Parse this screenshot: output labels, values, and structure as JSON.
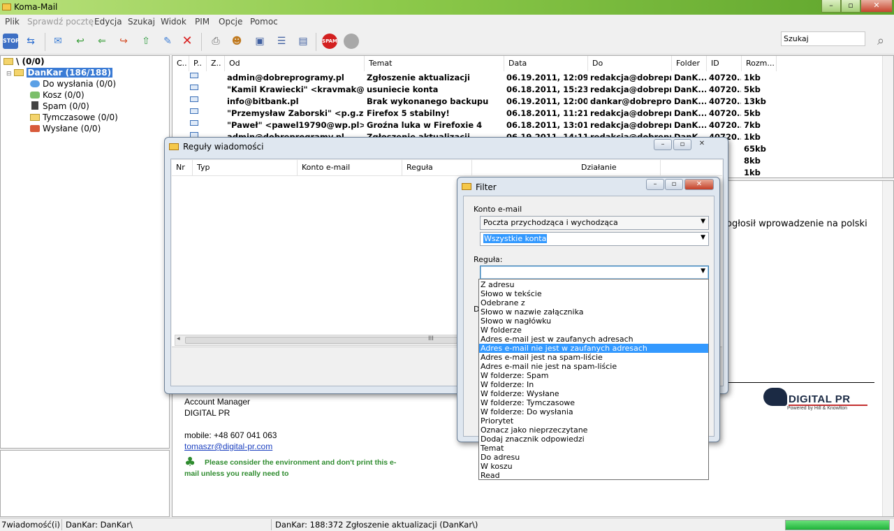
{
  "window": {
    "title": "Koma-Mail"
  },
  "menu": [
    "Plik",
    "Sprawdź pocztę",
    "Edycja",
    "Szukaj",
    "Widok",
    "PIM",
    "Opcje",
    "Pomoc"
  ],
  "search": {
    "value": "Szukaj"
  },
  "folders": {
    "root": "\\ (0/0)",
    "account": "DanKar (186/188)",
    "items": [
      "Do wysłania (0/0)",
      "Kosz (0/0)",
      "Spam (0/0)",
      "Tymczasowe (0/0)",
      "Wysłane (0/0)"
    ]
  },
  "messages": {
    "columns": [
      "C..",
      "P..",
      "Z..",
      "Od",
      "Temat",
      "Data",
      "Do",
      "Folder",
      "ID",
      "Rozm..."
    ],
    "rows": [
      {
        "from": "admin@dobreprogramy.pl",
        "subject": "Zgłoszenie aktualizacji",
        "date": "06.19.2011, 12:09:...",
        "to": "redakcja@dobrepr...",
        "folder": "DanK...",
        "id": "40720...",
        "size": "1kb"
      },
      {
        "from": "\"Kamil Krawiecki\" <kravmak@g...",
        "subject": "usuniecie konta",
        "date": "06.18.2011, 15:23:...",
        "to": "redakcja@dobrepr...",
        "folder": "DanK...",
        "id": "40720...",
        "size": "5kb"
      },
      {
        "from": "info@bitbank.pl",
        "subject": "Brak wykonanego backupu",
        "date": "06.19.2011, 12:00:...",
        "to": "dankar@dobrepro...",
        "folder": "DanK...",
        "id": "40720...",
        "size": "13kb"
      },
      {
        "from": "\"Przemysław Zaborski\" <p.g.zab...",
        "subject": "Firefox 5 stabilny!",
        "date": "06.18.2011, 11:21:...",
        "to": "redakcja@dobrepr...",
        "folder": "DanK...",
        "id": "40720...",
        "size": "5kb"
      },
      {
        "from": "\"Paweł\" <pawel19790@wp.pl>",
        "subject": "Groźna luka w Firefoxie 4",
        "date": "06.18.2011, 13:01:...",
        "to": "redakcja@dobrepr...",
        "folder": "DanK...",
        "id": "40720...",
        "size": "7kb"
      },
      {
        "from": "admin@dobreprogramy.pl",
        "subject": "Zgłoszenie aktualizacji",
        "date": "06.19.2011, 14:11:...",
        "to": "redakcja@dobrepr...",
        "folder": "DanK...",
        "id": "40720...",
        "size": "1kb"
      },
      {
        "from": "",
        "subject": "",
        "date": "",
        "to": "",
        "folder": "",
        "id": "...",
        "size": "65kb"
      },
      {
        "from": "",
        "subject": "",
        "date": "",
        "to": "",
        "folder": "",
        "id": "...",
        "size": "8kb"
      },
      {
        "from": "",
        "subject": "",
        "date": "",
        "to": "",
        "folder": "",
        "id": "...",
        "size": "1kb"
      }
    ]
  },
  "preview": {
    "text_fragment": "ogłosił wprowadzenie na polski",
    "signature": {
      "role": "Account Manager",
      "company": "DIGITAL PR",
      "mobile": "mobile: +48 607 041 063",
      "email": "tomaszr@digital-pr.com",
      "eco_line1": "Please consider the environment and don't print this e-",
      "eco_line2": "mail unless you really need to",
      "logo_text": "DIGITAL PR",
      "logo_sub": "Powered by Hill & Knowlton"
    }
  },
  "rules_dialog": {
    "title": "Reguły wiadomości",
    "columns": [
      "Nr",
      "Typ",
      "Konto e-mail",
      "Reguła",
      "Działanie"
    ],
    "scroll_grip": "III"
  },
  "filter_dialog": {
    "title": "Filter",
    "account_label": "Konto e-mail",
    "direction_value": "Poczta przychodząca i wychodząca",
    "account_value": "Wszystkie konta",
    "rule_label": "Reguła:",
    "rule_value": "",
    "partial_label": "D",
    "options": [
      "Z adresu",
      "Słowo w tekście",
      "Odebrane z",
      "Słowo w nazwie załącznika",
      "Słowo w nagłówku",
      "W folderze",
      "Adres e-mail jest w zaufanych adresach",
      "Adres e-mail nie jest w zaufanych adresach",
      "Adres e-mail jest na spam-liście",
      "Adres e-mail nie jest na spam-liście",
      "W folderze: Spam",
      "W folderze: In",
      "W folderze: Wysłane",
      "W folderze: Tymczasowe",
      "W folderze: Do wysłania",
      "Priorytet",
      "Oznacz jako nieprzeczytane",
      "Dodaj znacznik odpowiedzi",
      "Temat",
      "Do adresu",
      "W koszu",
      "Read"
    ],
    "selected_index": 7
  },
  "status": {
    "count": "7wiadomość(i)",
    "account": "DanKar: DanKar\\",
    "message": "DanKar: 188:372 Zgłoszenie aktualizacji (DanKar\\)",
    "progress": 1.0
  },
  "colors": {
    "title_green": "#8cc94a",
    "selection_blue": "#3399ff",
    "account_highlight": "#3a7bd5",
    "eco_green": "#2e8b2e",
    "progress_green": "#22c13a"
  }
}
